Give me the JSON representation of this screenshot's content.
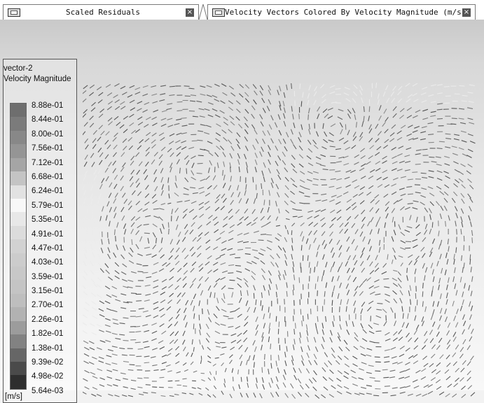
{
  "tabs": [
    {
      "label": "Scaled Residuals",
      "icon": "graphics-window-icon",
      "close": "×"
    },
    {
      "label": "Velocity Vectors Colored By Velocity Magnitude (m/s)",
      "icon": "graphics-window-icon",
      "close": "×"
    }
  ],
  "legend": {
    "title_line1": "vector-2",
    "title_line2": "Velocity Magnitude",
    "labels": [
      "8.88e-01",
      "8.44e-01",
      "8.00e-01",
      "7.56e-01",
      "7.12e-01",
      "6.68e-01",
      "6.24e-01",
      "5.79e-01",
      "5.35e-01",
      "4.91e-01",
      "4.47e-01",
      "4.03e-01",
      "3.59e-01",
      "3.15e-01",
      "2.70e-01",
      "2.26e-01",
      "1.82e-01",
      "1.38e-01",
      "9.39e-02",
      "4.98e-02",
      "5.64e-03"
    ],
    "unit": "[m/s]",
    "swatch_colors": [
      "#6e6e6e",
      "#7b7b7b",
      "#888888",
      "#959595",
      "#a5a5a5",
      "#c4c4c4",
      "#e2e2e2",
      "#f8f8f8",
      "#e8e8e8",
      "#dcdcdc",
      "#d2d2d2",
      "#cccccc",
      "#c8c8c8",
      "#c4c4c4",
      "#bebebe",
      "#b2b2b2",
      "#9c9c9c",
      "#828282",
      "#666666",
      "#4a4a4a",
      "#2e2e2e"
    ]
  },
  "colors": {
    "viewport_top": "#c9c9c9",
    "viewport_bottom": "#f8f8f8",
    "vector": "#3a3a3a"
  }
}
